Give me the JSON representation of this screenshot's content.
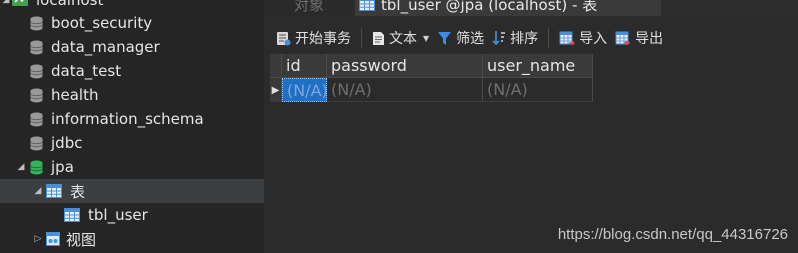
{
  "nav": {
    "connection_label": "localhost",
    "databases": [
      "boot_security",
      "data_manager",
      "data_test",
      "health",
      "information_schema",
      "jdbc",
      "jpa"
    ],
    "tables_label": "表",
    "table_item": "tbl_user",
    "views_label": "视图"
  },
  "tabs": {
    "objects_label": "对象",
    "active_label": "tbl_user @jpa (localhost) - 表"
  },
  "toolbar": {
    "begin_transaction": "开始事务",
    "text": "文本",
    "filter": "筛选",
    "sort": "排序",
    "import": "导入",
    "export": "导出"
  },
  "grid": {
    "columns": [
      "id",
      "password",
      "user_name"
    ],
    "rows": [
      [
        "(N/A)",
        "(N/A)",
        "(N/A)"
      ]
    ]
  },
  "watermark": "https://blog.csdn.net/qq_44316726",
  "colors": {
    "db_icon": "#9a9a9a",
    "db_icon_active": "#35b35a",
    "table_icon": "#4a90d9",
    "selection": "#1f6fc5",
    "filter_icon": "#3a8ee6"
  }
}
